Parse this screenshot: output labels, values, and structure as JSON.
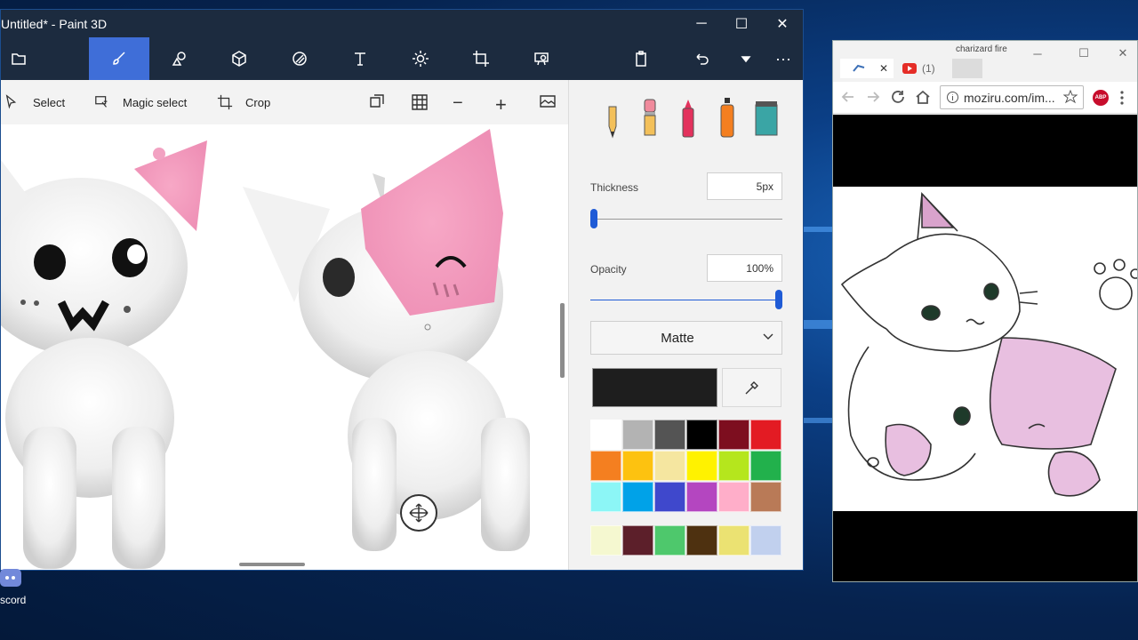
{
  "paint3d": {
    "title": "Untitled* - Paint 3D",
    "window_controls": {
      "minimize": "─",
      "maximize": "☐",
      "close": "✕"
    },
    "toolbar_tools": [
      "folder-icon",
      "brushes-icon",
      "2d-shapes-icon",
      "3d-shapes-icon",
      "stickers-icon",
      "text-icon",
      "effects-icon",
      "canvas-icon",
      "remix3d-icon"
    ],
    "toolbar_right": [
      "paste-icon",
      "undo-icon",
      "history-dropdown-icon",
      "more-icon"
    ],
    "more_label": "···",
    "subtoolbar": {
      "select_label": "Select",
      "magic_select_label": "Magic select",
      "crop_label": "Crop",
      "zoom_out": "−",
      "zoom_in": "+"
    },
    "panel": {
      "thickness_label": "Thickness",
      "thickness_value": "5px",
      "thickness_fraction": 0.0,
      "opacity_label": "Opacity",
      "opacity_value": "100%",
      "opacity_fraction": 1.0,
      "material": "Matte",
      "current_color": "#1e1e1e",
      "brush_tools": [
        "pencil-icon",
        "eraser-icon",
        "crayon-icon",
        "spray-can-icon",
        "fill-bucket-icon"
      ],
      "palette": [
        "#ffffff",
        "#b3b3b3",
        "#545454",
        "#000000",
        "#7d0e1f",
        "#e31b23",
        "#f47f20",
        "#fdc210",
        "#f5e6a0",
        "#fff200",
        "#b5e61d",
        "#22b14c",
        "#8cf6f6",
        "#00a2e8",
        "#3f48cc",
        "#b446c0",
        "#ffaec9",
        "#b97a57"
      ],
      "custom_palette": [
        "#f5f8d0",
        "#5c1f2a",
        "#4ec86c",
        "#4e3110",
        "#ebe272",
        "#c1d0ee"
      ]
    }
  },
  "chrome": {
    "title": "charizard fire",
    "tab1_close": "✕",
    "tab2_label": "(1)",
    "url": "moziru.com/im...",
    "window_controls": {
      "minimize": "─",
      "maximize": "☐",
      "close": "✕"
    },
    "abp_label": "ABP"
  },
  "desktop": {
    "icon_label": "scord"
  }
}
